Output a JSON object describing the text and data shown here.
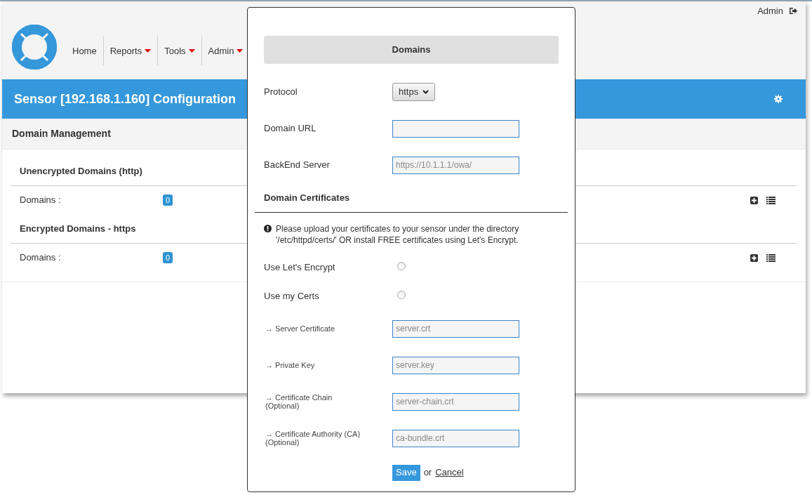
{
  "user_menu": {
    "user": "Admin"
  },
  "nav": [
    {
      "label": "Home",
      "has_menu": false
    },
    {
      "label": "Reports",
      "has_menu": true
    },
    {
      "label": "Tools",
      "has_menu": true
    },
    {
      "label": "Admin",
      "has_menu": true
    }
  ],
  "title_bar": {
    "title": "Sensor [192.168.1.160] Configuration"
  },
  "section_title": "Domain Management",
  "groups": [
    {
      "heading": "Unencrypted Domains (http)",
      "rows": [
        {
          "label": "Domains :",
          "count": "0"
        }
      ]
    },
    {
      "heading": "Encrypted Domains - https",
      "rows": [
        {
          "label": "Domains :",
          "count": "0"
        }
      ]
    }
  ],
  "modal": {
    "heading": "Domains",
    "rows": [
      {
        "kind": "select",
        "label": "Protocol",
        "value": "https"
      },
      {
        "kind": "input",
        "label": "Domain URL",
        "placeholder": ""
      },
      {
        "kind": "input",
        "label": "BackEnd Server",
        "placeholder": "https://10.1.1.1/owa/"
      },
      {
        "kind": "heading",
        "label": "Domain Certificates"
      },
      {
        "kind": "note",
        "label": "Please upload your certificates to your sensor under the directory '/etc/httpd/certs/' OR install FREE certificates using Let's Encrypt."
      },
      {
        "kind": "radio",
        "label": "Use Let's Encrypt",
        "checked": false
      },
      {
        "kind": "radio",
        "label": "Use my Certs",
        "checked": false
      },
      {
        "kind": "path",
        "label": "→ Server Certificate",
        "placeholder": "server.crt"
      },
      {
        "kind": "path",
        "label": "→ Private Key",
        "placeholder": "server.key"
      },
      {
        "kind": "path",
        "label": "→ Certificate Chain (Optional)",
        "placeholder": "server-chain.crt"
      },
      {
        "kind": "path",
        "label": "→ Certificate Authority (CA) (Optional)",
        "placeholder": "ca-bundle.crt"
      }
    ],
    "save": "Save",
    "joiner": "or",
    "cancel": "Cancel"
  }
}
